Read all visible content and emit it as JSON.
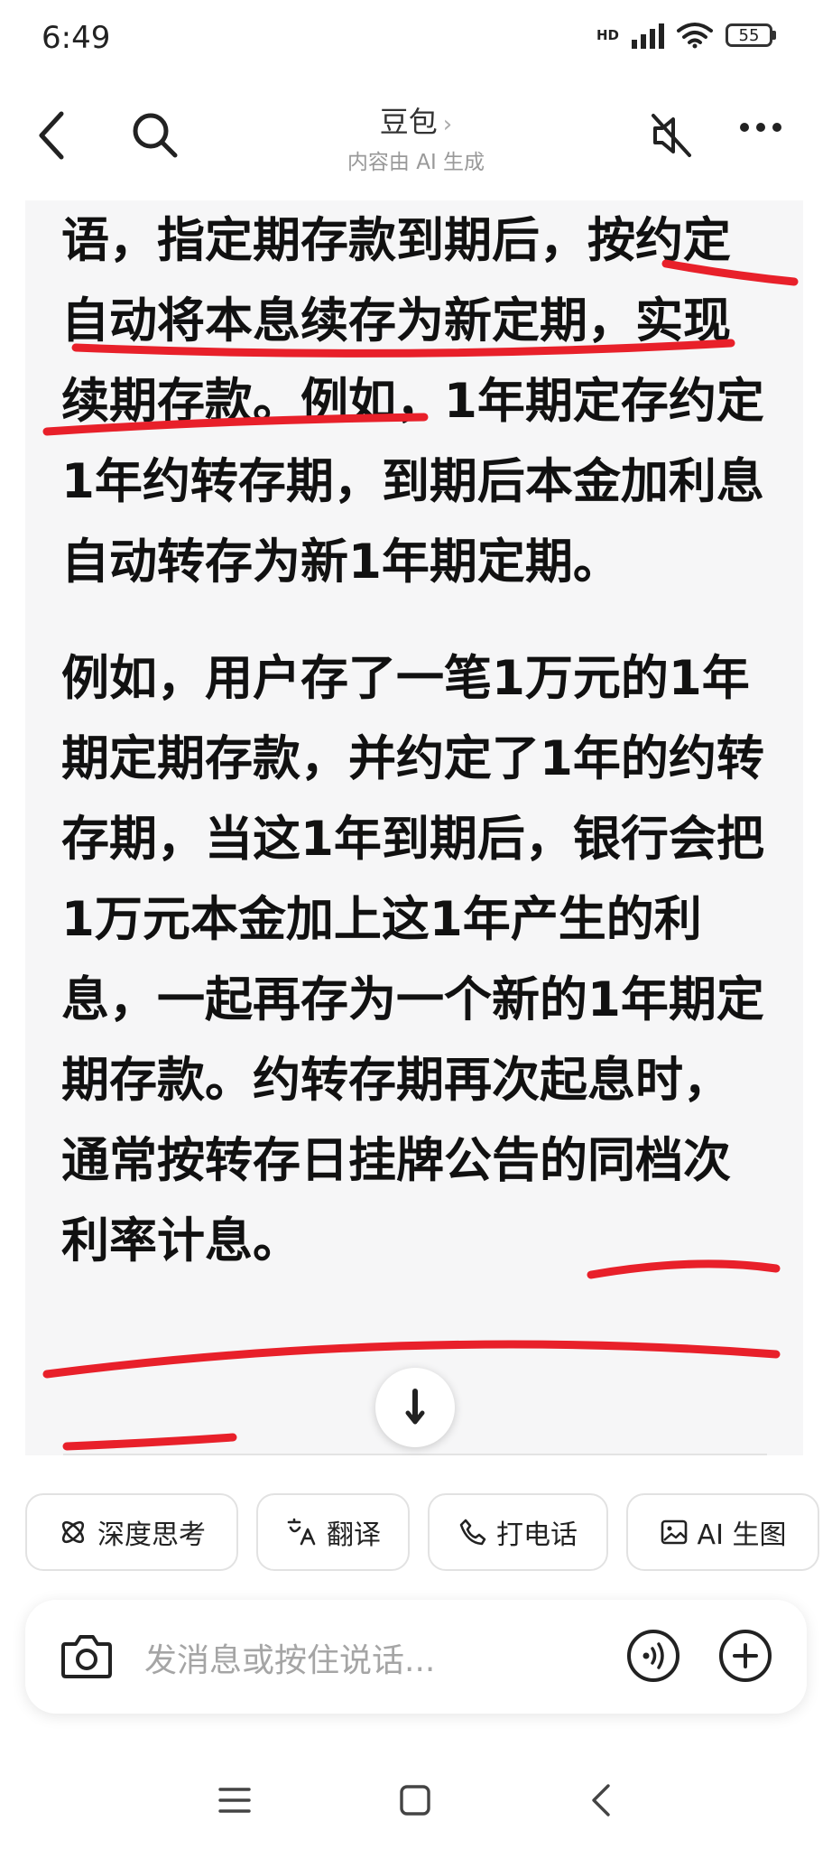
{
  "status_bar": {
    "time": "6:49",
    "network": "HD",
    "battery": "55"
  },
  "header": {
    "title": "豆包",
    "subtitle": "内容由 AI 生成"
  },
  "message": {
    "paragraph1": "语，指定期存款到期后，按约定自动将本息续存为新定期，实现续期存款。例如，1年期定存约定1年约转存期，到期后本金加利息自动转存为新1年期定期。",
    "paragraph2": "例如，用户存了一笔1万元的1年期定期存款，并约定了1年的约转存期，当这1年到期后，银行会把1万元本金加上这1年产生的利息，一起再存为一个新的1年期定期存款。约转存期再次起息时，通常按转存日挂牌公告的同档次利率计息。"
  },
  "chips": [
    {
      "label": "深度思考",
      "icon": "atom-icon"
    },
    {
      "label": "翻译",
      "icon": "translate-icon"
    },
    {
      "label": "打电话",
      "icon": "phone-icon"
    },
    {
      "label": "AI 生图",
      "icon": "image-icon"
    }
  ],
  "composer": {
    "placeholder": "发消息或按住说话..."
  },
  "colors": {
    "annotation": "#e8202a",
    "message_bg": "#f6f6f7"
  }
}
